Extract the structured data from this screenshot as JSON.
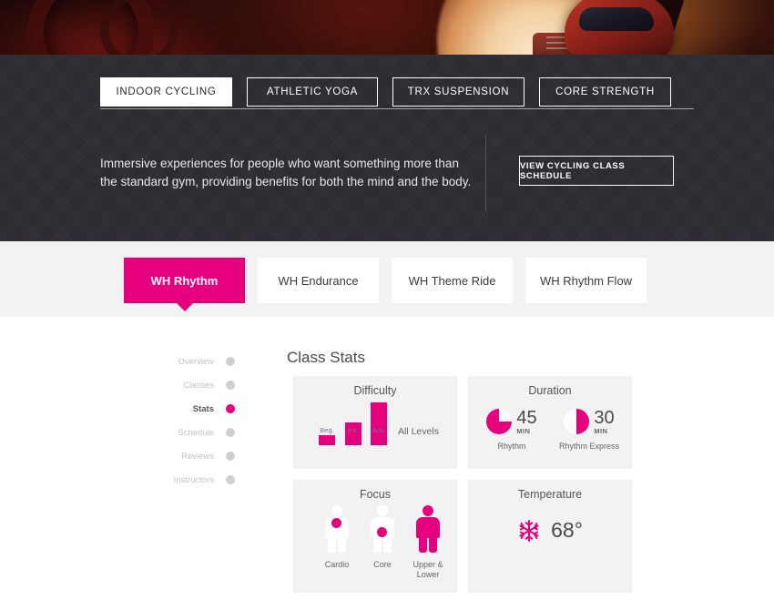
{
  "hero": {
    "alt": "cycling-hero-image"
  },
  "category_nav": {
    "tabs": [
      {
        "label": "INDOOR CYCLING",
        "active": true
      },
      {
        "label": "ATHLETIC YOGA",
        "active": false
      },
      {
        "label": "TRX SUSPENSION",
        "active": false
      },
      {
        "label": "CORE STRENGTH",
        "active": false
      }
    ]
  },
  "intro": {
    "description": "Immersive experiences for people who want something more than the standard gym, providing benefits for both the mind and the body.",
    "cta_label": "VIEW CYCLING CLASS SCHEDULE"
  },
  "class_tabs": [
    {
      "label": "WH Rhythm",
      "active": true
    },
    {
      "label": "WH Endurance",
      "active": false
    },
    {
      "label": "WH Theme Ride",
      "active": false
    },
    {
      "label": "WH Rhythm Flow",
      "active": false
    }
  ],
  "side_nav": {
    "items": [
      {
        "label": "Overview",
        "active": false
      },
      {
        "label": "Classes",
        "active": false
      },
      {
        "label": "Stats",
        "active": true
      },
      {
        "label": "Schedule",
        "active": false
      },
      {
        "label": "Reviews",
        "active": false
      },
      {
        "label": "Instructors",
        "active": false
      }
    ]
  },
  "stats": {
    "heading": "Class Stats",
    "difficulty": {
      "title": "Difficulty",
      "summary": "All Levels",
      "bars": [
        {
          "label": "Beg.",
          "value": 22
        },
        {
          "label": "Int.",
          "value": 52
        },
        {
          "label": "Adv.",
          "value": 100
        }
      ]
    },
    "duration": {
      "title": "Duration",
      "entries": [
        {
          "value": "45",
          "unit": "MIN",
          "caption": "Rhythm",
          "percent": 75
        },
        {
          "value": "30",
          "unit": "MIN",
          "caption": "Rhythm Express",
          "percent": 50
        }
      ]
    },
    "focus": {
      "title": "Focus",
      "entries": [
        {
          "caption": "Cardio",
          "icon": "figure-chest-dot"
        },
        {
          "caption": "Core",
          "icon": "figure-core-dot"
        },
        {
          "caption": "Upper & Lower",
          "icon": "figure-filled"
        }
      ]
    },
    "temperature": {
      "title": "Temperature",
      "value": "68°",
      "icon": "snowflake-icon"
    }
  },
  "colors": {
    "accent": "#e6007e",
    "dark_nav": "#2e2b33",
    "band": "#f2f2f2",
    "card": "#f2f2f2",
    "dot_inactive": "#cfcfcf"
  },
  "chart_data": [
    {
      "type": "bar",
      "title": "Difficulty",
      "categories": [
        "Beg.",
        "Int.",
        "Adv."
      ],
      "values": [
        22,
        52,
        100
      ],
      "xlabel": "",
      "ylabel": "",
      "ylim": [
        0,
        100
      ],
      "annotation": "All Levels",
      "grid": false,
      "legend": "none",
      "color": "#e6007e"
    },
    {
      "type": "pie",
      "title": "Duration",
      "categories": [
        "Rhythm",
        "Rhythm Express"
      ],
      "values": [
        75,
        50
      ],
      "labels": [
        "45 MIN",
        "30 MIN"
      ],
      "legend": "below",
      "color": "#e6007e"
    }
  ]
}
